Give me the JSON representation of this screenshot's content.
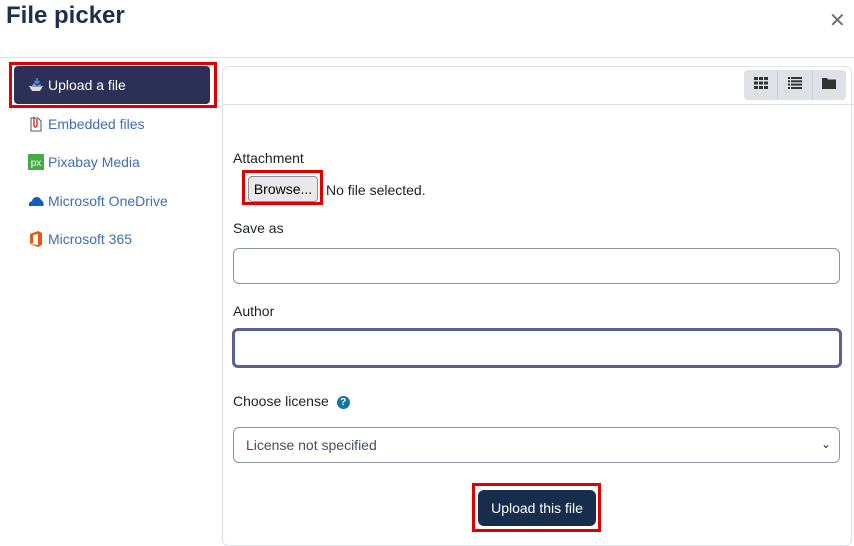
{
  "dialog": {
    "title": "File picker",
    "close_icon": "close-icon"
  },
  "sidebar": {
    "items": [
      {
        "label": "Upload a file",
        "icon": "upload-icon",
        "active": true
      },
      {
        "label": "Embedded files",
        "icon": "embedded-files-icon",
        "active": false
      },
      {
        "label": "Pixabay Media",
        "icon": "pixabay-icon",
        "active": false
      },
      {
        "label": "Microsoft OneDrive",
        "icon": "onedrive-icon",
        "active": false
      },
      {
        "label": "Microsoft 365",
        "icon": "microsoft-365-icon",
        "active": false
      }
    ]
  },
  "view_toolbar": {
    "buttons": [
      {
        "name": "icons-view",
        "icon": "grid-icon"
      },
      {
        "name": "details-view",
        "icon": "list-icon"
      },
      {
        "name": "tree-view",
        "icon": "folder-icon"
      }
    ]
  },
  "form": {
    "attachment_label": "Attachment",
    "browse_label": "Browse...",
    "no_file_text": "No file selected.",
    "save_as_label": "Save as",
    "save_as_value": "",
    "author_label": "Author",
    "author_value": "",
    "license_label": "Choose license",
    "license_help_icon": "?",
    "license_selected": "License not specified",
    "submit_label": "Upload this file"
  },
  "colors": {
    "primary": "#162d4d",
    "sidebar_active": "#2c3057",
    "link": "#3c6fb0",
    "highlight": "#e00000"
  }
}
